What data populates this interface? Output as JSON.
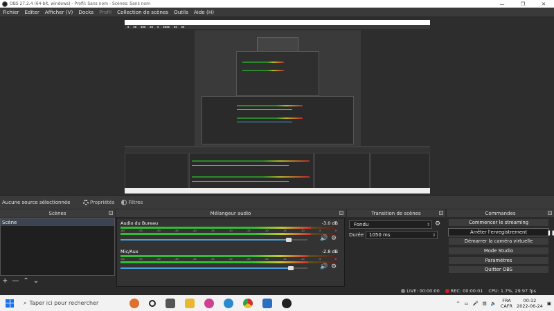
{
  "window": {
    "title": "OBS 27.2.4 (64-bit, windows) - Profil: Sans nom - Scènes: Sans nom"
  },
  "menu": [
    "Fichier",
    "Editer",
    "Afficher (V)",
    "Docks",
    "Profil",
    "Collection de scènes",
    "Outils",
    "Aide (H)"
  ],
  "source_bar": {
    "no_source": "Aucune source sélectionnée",
    "properties": "Propriétés",
    "filters": "Filtres"
  },
  "scenes": {
    "header": "Scènes",
    "items": [
      "Scène"
    ]
  },
  "mixer": {
    "header": "Mélangeur audio",
    "tracks": [
      {
        "name": "Audio du Bureau",
        "db": "-3.0 dB",
        "level": 0.88,
        "volume": 0.9
      },
      {
        "name": "Mic/Aux",
        "db": "-2.8 dB",
        "level": 0.87,
        "volume": 0.91
      }
    ],
    "scale": [
      "-60",
      "-55",
      "-50",
      "-45",
      "-40",
      "-35",
      "-30",
      "-25",
      "-20",
      "-15",
      "-10",
      "-5",
      "0"
    ]
  },
  "transitions": {
    "header": "Transition de scènes",
    "selected": "Fondu",
    "duration_label": "Durée",
    "duration": "1050 ms"
  },
  "commands": {
    "header": "Commandes",
    "buttons": [
      "Commencer le streaming",
      "Arrêter l'enregistrement",
      "Démarrer la caméra virtuelle",
      "Mode Studio",
      "Paramètres",
      "Quitter OBS"
    ]
  },
  "status": {
    "live": "LIVE: 00:00:00",
    "rec": "REC: 00:00:01",
    "cpu": "CPU: 1.7%, 29.97 fps"
  },
  "taskbar": {
    "search_placeholder": "Taper ici pour rechercher",
    "lang_top": "FRA",
    "lang_bottom": "CAFR",
    "time": "00:12",
    "date": "2022-06-24"
  },
  "colors": {
    "accent_blue": "#4aa0e0",
    "rec_red": "#d02020",
    "scene_selected": "#3c4452"
  }
}
